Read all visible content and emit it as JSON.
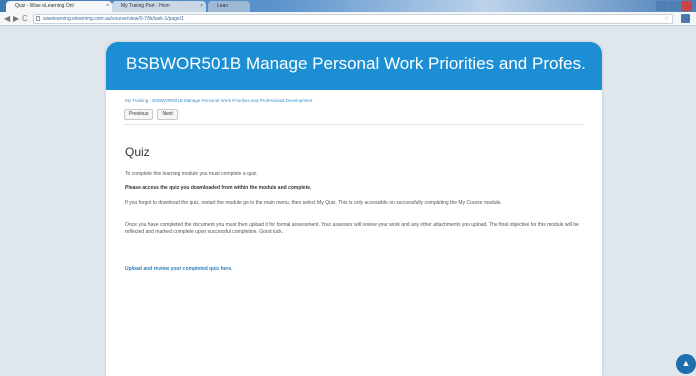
{
  "browser": {
    "tabs": [
      {
        "label": "Quiz - Wise eLearning Onl",
        "close": "×"
      },
      {
        "label": "My Trainig Port - Hom",
        "close": "×"
      },
      {
        "label": "Lean",
        "close": ""
      }
    ],
    "back": "◀",
    "forward": "▶",
    "reload": "C",
    "url": "wiselearning.elearning.com.au/course/view/0-7/lb/task-1/page/1",
    "star": "☆"
  },
  "page": {
    "title": "BSBWOR501B Manage Personal Work Priorities and Profes.",
    "breadcrumb": "My Training  ›  BSBWOR501B Manage Personal Work Priorities and Professional Development",
    "buttons": {
      "previous": "Previous",
      "next": "Next"
    },
    "heading": "Quiz",
    "paragraphs": [
      "To complete this learning module you must complete a quiz.",
      "Please access the quiz you downloaded from within the module and complete.",
      "If you forgot to download the quiz, restart the module go to the main menu, then select My Quiz. This is only accessible on successfully completing the My Course module.",
      "Once you have completed the document you must then upload it for formal assessment. Your assessor will review your work and any other attachments you upload. The final objective for this module will be reflected and marked complete upon successful completion. Good luck."
    ],
    "link": "Upload and review your completed quiz here.",
    "scroll_top": "▲"
  },
  "colors": {
    "header_blue": "#1c8fd4",
    "background": "#dfe6ec"
  }
}
